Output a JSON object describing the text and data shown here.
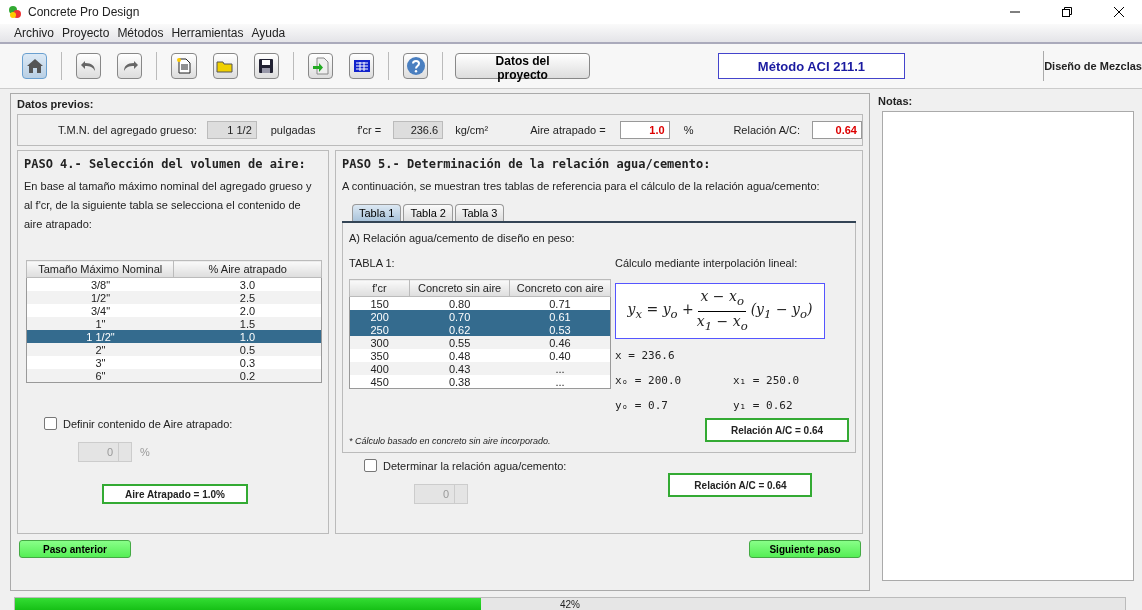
{
  "window": {
    "title": "Concrete Pro Design"
  },
  "menu": [
    {
      "label": "Archivo"
    },
    {
      "label": "Proyecto"
    },
    {
      "label": "Métodos"
    },
    {
      "label": "Herramientas"
    },
    {
      "label": "Ayuda"
    }
  ],
  "toolbar": {
    "tools": [
      {
        "kind": "home",
        "selected": true
      },
      {
        "kind": "sep"
      },
      {
        "kind": "undo",
        "selected": false
      },
      {
        "kind": "redo",
        "selected": false
      },
      {
        "kind": "sep"
      },
      {
        "kind": "new",
        "selected": false
      },
      {
        "kind": "open",
        "selected": false
      },
      {
        "kind": "save",
        "selected": false
      },
      {
        "kind": "sep"
      },
      {
        "kind": "export",
        "selected": false
      },
      {
        "kind": "table",
        "selected": false
      },
      {
        "kind": "sep"
      },
      {
        "kind": "help",
        "selected": false
      },
      {
        "kind": "sep"
      }
    ],
    "project_button": "Datos del proyecto",
    "method": "Método ACI 211.1",
    "module": "Diseño de Mezclas"
  },
  "datos_previos": {
    "title": "Datos previos:",
    "tmn_label": "T.M.N. del agregado grueso:",
    "tmn_value": "1 1/2",
    "tmn_unit": "pulgadas",
    "fcr_label": "f'cr =",
    "fcr_value": "236.6",
    "fcr_unit": "kg/cm²",
    "aire_label": "Aire atrapado =",
    "aire_value": "1.0",
    "aire_unit": "%",
    "ac_label": "Relación A/C:",
    "ac_value": "0.64"
  },
  "paso4": {
    "title": "PASO 4.- Selección del volumen de aire:",
    "text": "En base al tamaño máximo nominal del agregado grueso y al f'cr, de la siguiente tabla se selecciona el contenido de aire atrapado:",
    "columns": [
      "Tamaño Máximo Nominal",
      "% Aire atrapado"
    ],
    "rows": [
      {
        "cells": [
          "3/8\"",
          "3.0"
        ],
        "selected": false
      },
      {
        "cells": [
          "1/2\"",
          "2.5"
        ],
        "selected": false
      },
      {
        "cells": [
          "3/4\"",
          "2.0"
        ],
        "selected": false
      },
      {
        "cells": [
          "1\"",
          "1.5"
        ],
        "selected": false
      },
      {
        "cells": [
          "1 1/2\"",
          "1.0"
        ],
        "selected": true
      },
      {
        "cells": [
          "2\"",
          "0.5"
        ],
        "selected": false
      },
      {
        "cells": [
          "3\"",
          "0.3"
        ],
        "selected": false
      },
      {
        "cells": [
          "6\"",
          "0.2"
        ],
        "selected": false
      }
    ],
    "checkbox": {
      "label": "Definir contenido de Aire atrapado:",
      "checked": false
    },
    "spinner": {
      "value": "0",
      "unit": "%",
      "disabled": true
    },
    "result": "Aire Atrapado = 1.0%"
  },
  "paso5": {
    "title": "PASO 5.- Determinación de la relación agua/cemento:",
    "text": "A continuación, se muestran tres tablas de referencia para el cálculo de la relación agua/cemento:",
    "tabs": [
      {
        "label": "Tabla 1",
        "selected": true
      },
      {
        "label": "Tabla 2",
        "selected": false
      },
      {
        "label": "Tabla 3",
        "selected": false
      }
    ],
    "subtitle": "A) Relación agua/cemento de diseño en peso:",
    "table_title": "TABLA 1:",
    "columns": [
      "f'cr",
      "Concreto sin aire",
      "Concreto con aire"
    ],
    "rows": [
      {
        "cells": [
          "150",
          "0.80",
          "0.71"
        ],
        "selected": false
      },
      {
        "cells": [
          "200",
          "0.70",
          "0.61"
        ],
        "selected": true
      },
      {
        "cells": [
          "250",
          "0.62",
          "0.53"
        ],
        "selected": true
      },
      {
        "cells": [
          "300",
          "0.55",
          "0.46"
        ],
        "selected": false
      },
      {
        "cells": [
          "350",
          "0.48",
          "0.40"
        ],
        "selected": false
      },
      {
        "cells": [
          "400",
          "0.43",
          "..."
        ],
        "selected": false
      },
      {
        "cells": [
          "450",
          "0.38",
          "..."
        ],
        "selected": false
      }
    ],
    "note": "* Cálculo basado en concreto sin aire incorporado.",
    "interp_title": "Cálculo mediante interpolación lineal:",
    "formula": {
      "left": "y$_{x}$ = y$_{o}$ +",
      "numerator": "x − x$_{o}$",
      "denominator": "x$_{1}$ − x$_{o}$",
      "right": "(y$_{1}$ − y$_{o}$)"
    },
    "values": [
      "x = 236.6",
      "xₒ = 200.0",
      "x₁ = 250.0",
      "yₒ = 0.7",
      "y₁ = 0.62"
    ],
    "tab_result": "Relación A/C = 0.64",
    "checkbox": {
      "label": "Determinar la relación agua/cemento:",
      "checked": false
    },
    "spinner": {
      "value": "0",
      "disabled": true
    },
    "result": "Relación A/C = 0.64"
  },
  "nav": {
    "prev": "Paso anterior",
    "next": "Siguiente paso"
  },
  "notes": {
    "title": "Notas:"
  },
  "progress": {
    "level": 0.42,
    "text": "42%"
  }
}
